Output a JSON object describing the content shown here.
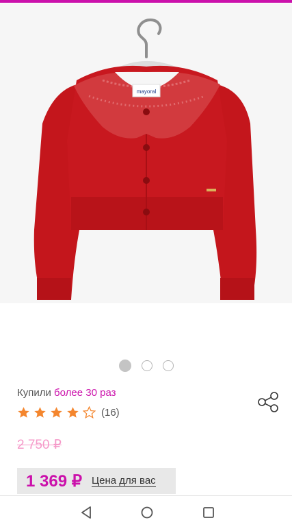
{
  "colors": {
    "accent": "#cb11ab",
    "old_price": "#f59ac9",
    "star": "#f4862e",
    "product": "#c4161c"
  },
  "gallery": {
    "image": "red knit cardigan with lace collar on a hanger",
    "brand_tag": "mayoral",
    "slide_count": 3,
    "active_slide": 1
  },
  "product": {
    "bought_prefix": "Купили",
    "bought_count": "более 30 раз",
    "rating": 4,
    "rating_max": 5,
    "review_count": "(16)",
    "old_price": "2 750 ₽",
    "price": "1 369 ₽",
    "price_label": "Цена для вас"
  },
  "icons": {
    "share": "share-icon",
    "back": "nav-back-icon",
    "home": "nav-home-icon",
    "recents": "nav-recents-icon"
  }
}
